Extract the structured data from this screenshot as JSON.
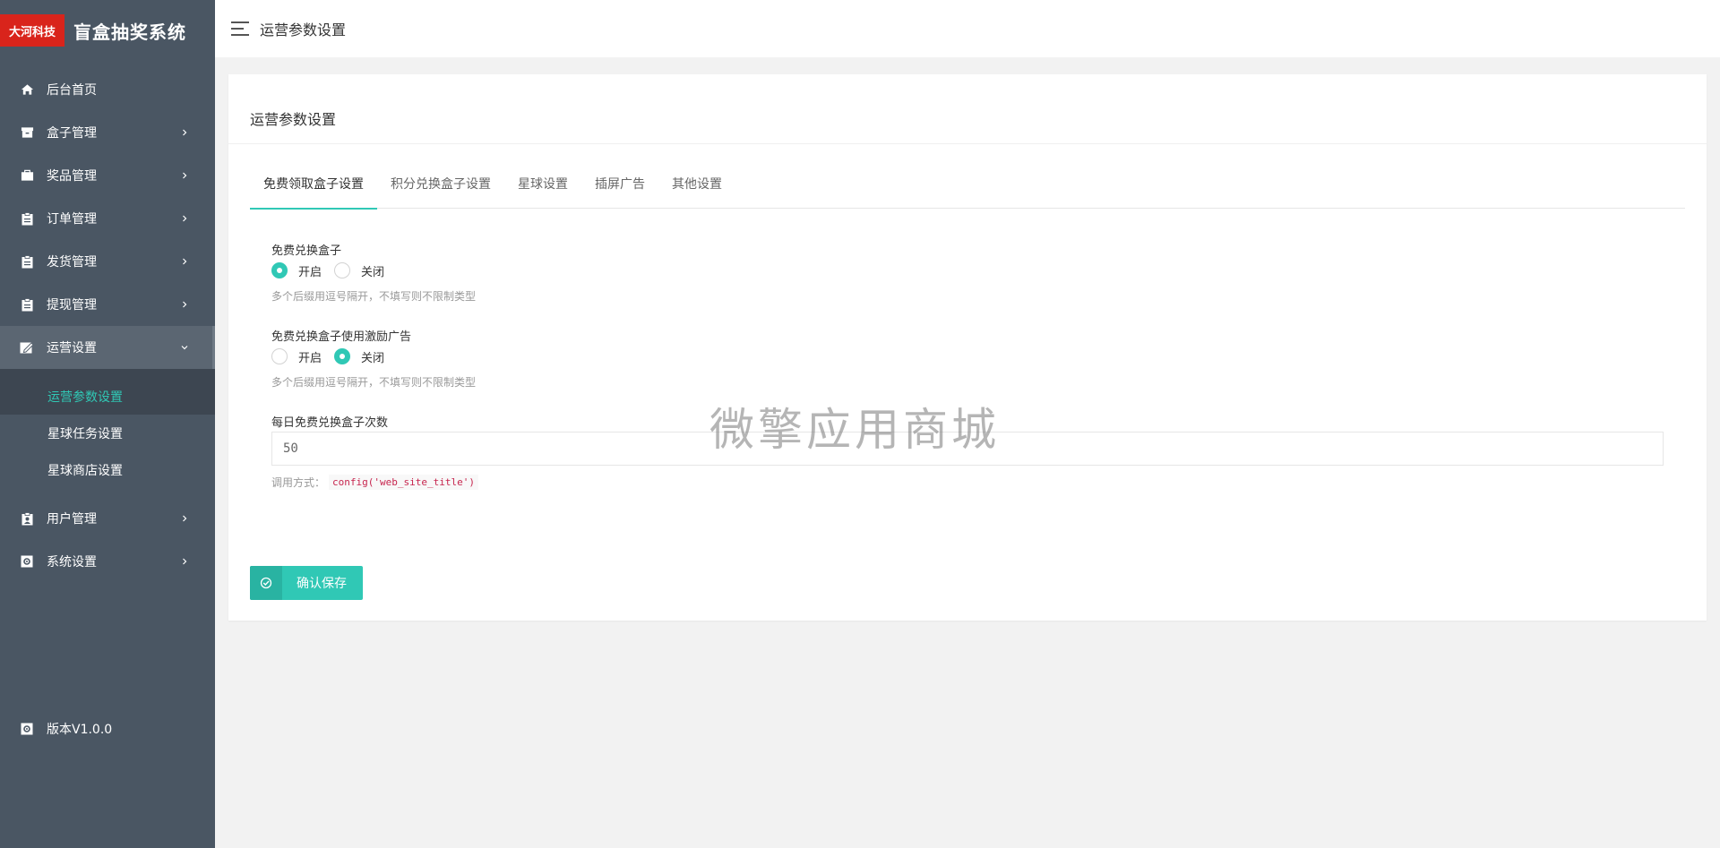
{
  "brand": {
    "badge": "大河科技",
    "name": "盲盒抽奖系统"
  },
  "sidebar": {
    "items": [
      {
        "label": "后台首页",
        "icon": "home-icon",
        "has_children": false
      },
      {
        "label": "盒子管理",
        "icon": "archive-icon",
        "has_children": true
      },
      {
        "label": "奖品管理",
        "icon": "gift-icon",
        "has_children": true
      },
      {
        "label": "订单管理",
        "icon": "clipboard-icon",
        "has_children": true
      },
      {
        "label": "发货管理",
        "icon": "clipboard-icon",
        "has_children": true
      },
      {
        "label": "提现管理",
        "icon": "clipboard-icon",
        "has_children": true
      },
      {
        "label": "运营设置",
        "icon": "edit-icon",
        "has_children": true,
        "expanded": true
      },
      {
        "label": "用户管理",
        "icon": "user-card-icon",
        "has_children": true
      },
      {
        "label": "系统设置",
        "icon": "gear-box-icon",
        "has_children": true
      }
    ],
    "submenu": [
      {
        "label": "运营参数设置",
        "active": true
      },
      {
        "label": "星球任务设置",
        "active": false
      },
      {
        "label": "星球商店设置",
        "active": false
      }
    ],
    "version": "版本V1.0.0"
  },
  "topbar": {
    "title": "运营参数设置"
  },
  "card": {
    "title": "运营参数设置",
    "tabs": [
      "免费领取盒子设置",
      "积分兑换盒子设置",
      "星球设置",
      "插屏广告",
      "其他设置"
    ],
    "active_tab": 0
  },
  "form": {
    "field1": {
      "label": "免费兑换盒子",
      "opt_on": "开启",
      "opt_off": "关闭",
      "selected": "开启",
      "hint": "多个后缀用逗号隔开，不填写则不限制类型"
    },
    "field2": {
      "label": "免费兑换盒子使用激励广告",
      "opt_on": "开启",
      "opt_off": "关闭",
      "selected": "关闭",
      "hint": "多个后缀用逗号隔开，不填写则不限制类型"
    },
    "field3": {
      "label": "每日免费兑换盒子次数",
      "value": "50",
      "hint_prefix": "调用方式：",
      "hint_code": "config('web_site_title')"
    }
  },
  "save_button": {
    "label": "确认保存"
  },
  "watermark": "微擎应用商城",
  "colors": {
    "accent": "#30c8b5",
    "sidebar": "#4a5663",
    "brand_red": "#d9241b"
  }
}
